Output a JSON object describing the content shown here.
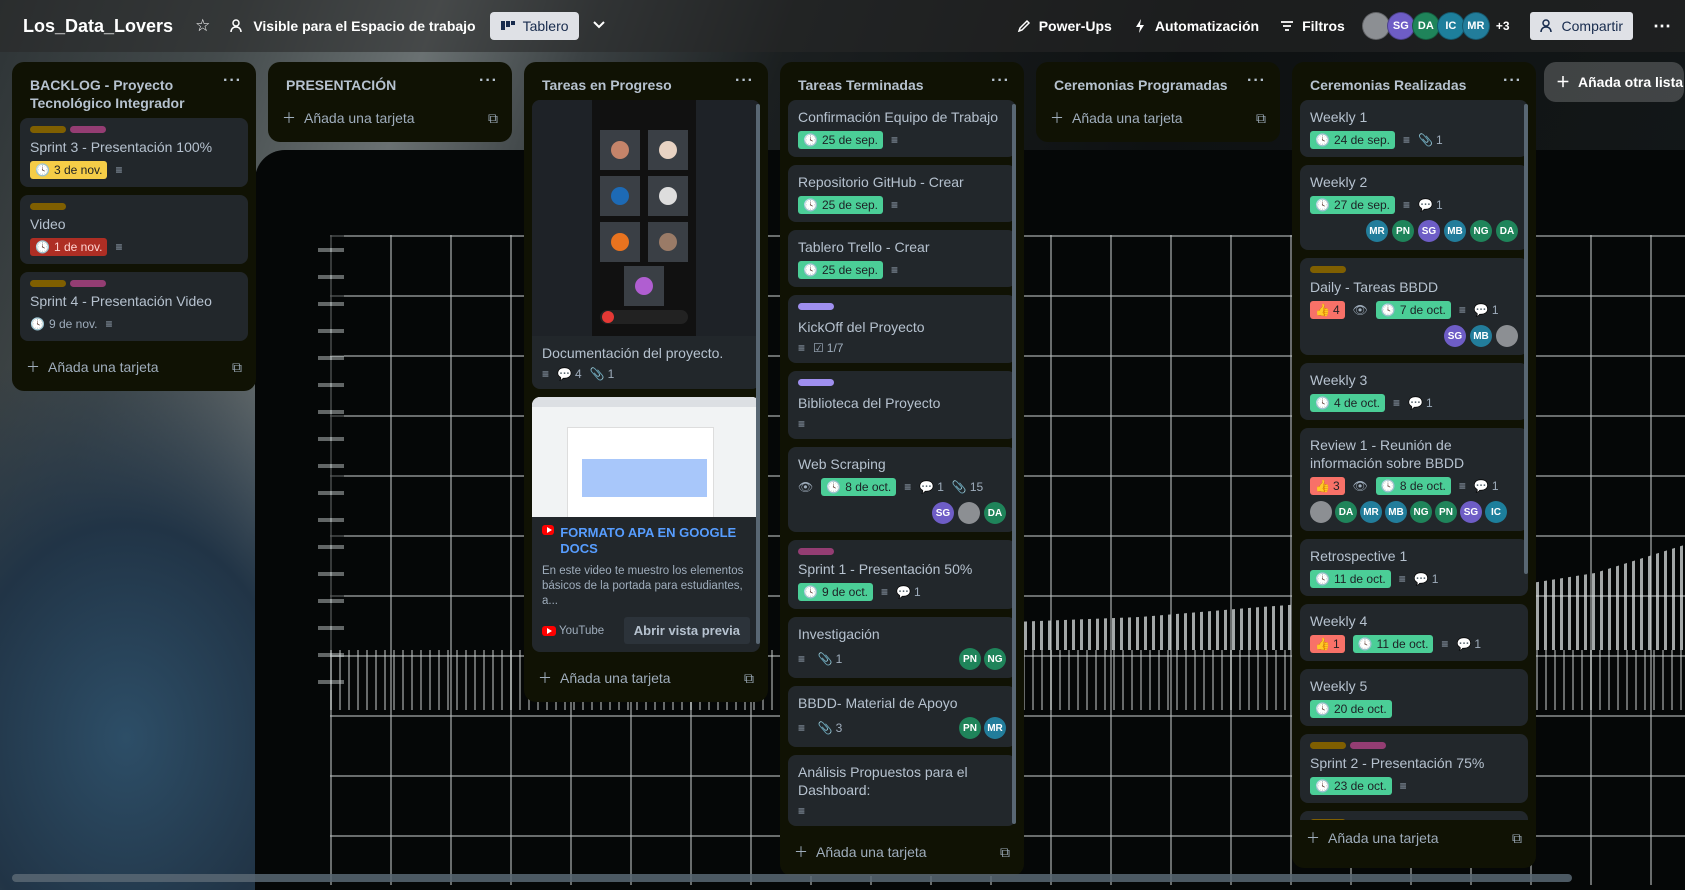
{
  "header": {
    "board_title": "Los_Data_Lovers",
    "visibility": "Visible para el Espacio de trabajo",
    "view": "Tablero",
    "powerups": "Power-Ups",
    "automation": "Automatización",
    "filters": "Filtros",
    "avatars": [
      {
        "initials": "",
        "color": "#8c8f93"
      },
      {
        "initials": "SG",
        "color": "#6e5dc6"
      },
      {
        "initials": "DA",
        "color": "#1f845a"
      },
      {
        "initials": "IC",
        "color": "#1d7f9c"
      },
      {
        "initials": "MR",
        "color": "#227d9b"
      }
    ],
    "more_members": "+3",
    "share": "Compartir"
  },
  "add_list": "Añada otra lista",
  "add_card": "Añada una tarjeta",
  "lists": [
    {
      "title": "BACKLOG - Proyecto Tecnológico Integrador",
      "cards": [
        {
          "title": "Sprint 3 - Presentación 100%",
          "date": "3 de nov."
        },
        {
          "title": "Video",
          "date": "1 de nov."
        },
        {
          "title": "Sprint 4 - Presentación Video",
          "date": "9 de nov."
        }
      ]
    },
    {
      "title": "PRESENTACIÓN",
      "cards": []
    },
    {
      "title": "Tareas en Progreso",
      "cards": [
        {
          "title": "Documentación del proyecto.",
          "comments": "4",
          "attachments": "1"
        },
        {
          "title": "FORMATO APA EN GOOGLE DOCS",
          "description": "En este video te muestro los elementos básicos de la portada para estudiantes, a...",
          "source": "YouTube",
          "preview": "Abrir vista previa"
        }
      ]
    },
    {
      "title": "Tareas Terminadas",
      "cards": [
        {
          "title": "Confirmación Equipo de Trabajo",
          "date": "25 de sep."
        },
        {
          "title": "Repositorio GitHub - Crear",
          "date": "25 de sep."
        },
        {
          "title": "Tablero Trello - Crear",
          "date": "25 de sep."
        },
        {
          "title": "KickOff del Proyecto",
          "checklist": "1/7"
        },
        {
          "title": "Biblioteca del Proyecto"
        },
        {
          "title": "Web Scraping",
          "date": "8 de oct.",
          "comments": "1",
          "attachments": "15",
          "members": [
            "SG",
            "",
            "DA"
          ]
        },
        {
          "title": "Sprint 1 - Presentación 50%",
          "date": "9 de oct.",
          "comments": "1"
        },
        {
          "title": "Investigación",
          "attachments": "1",
          "members": [
            "PN",
            "NG"
          ]
        },
        {
          "title": "BBDD- Material de Apoyo",
          "attachments": "3",
          "members": [
            "PN",
            "MR"
          ]
        },
        {
          "title": "Análisis Propuestos para el Dashboard:"
        }
      ]
    },
    {
      "title": "Ceremonias Programadas",
      "cards": []
    },
    {
      "title": "Ceremonias Realizadas",
      "cards": [
        {
          "title": "Weekly 1",
          "date": "24 de sep.",
          "attachments": "1"
        },
        {
          "title": "Weekly 2",
          "date": "27 de sep.",
          "comments": "1",
          "members": [
            "MR",
            "PN",
            "SG",
            "MB",
            "NG",
            "DA"
          ]
        },
        {
          "title": "Daily - Tareas BBDD",
          "votes": "4",
          "date": "7 de oct.",
          "comments": "1",
          "members": [
            "SG",
            "MB",
            ""
          ]
        },
        {
          "title": "Weekly 3",
          "date": "4 de oct.",
          "comments": "1"
        },
        {
          "title": "Review 1 - Reunión de información sobre BBDD",
          "votes": "3",
          "date": "8 de oct.",
          "comments": "1",
          "members": [
            "",
            "DA",
            "MR",
            "MB",
            "NG",
            "PN",
            "SG",
            "IC"
          ]
        },
        {
          "title": "Retrospective 1",
          "date": "11 de oct.",
          "comments": "1"
        },
        {
          "title": "Weekly 4",
          "votes": "1",
          "date": "11 de oct.",
          "comments": "1"
        },
        {
          "title": "Weekly 5",
          "date": "20 de oct."
        },
        {
          "title": "Sprint 2 - Presentación 75%",
          "date": "23 de oct."
        }
      ]
    }
  ],
  "colors": {
    "list_bg": "#101204",
    "card_bg": "#22272b",
    "date_done": "#4bce97",
    "date_soon": "#f5cd47",
    "date_overdue": "#ae2e24",
    "label_olive": "#7f5f01",
    "label_magenta": "#943d73",
    "label_purple": "#9f8fef"
  }
}
